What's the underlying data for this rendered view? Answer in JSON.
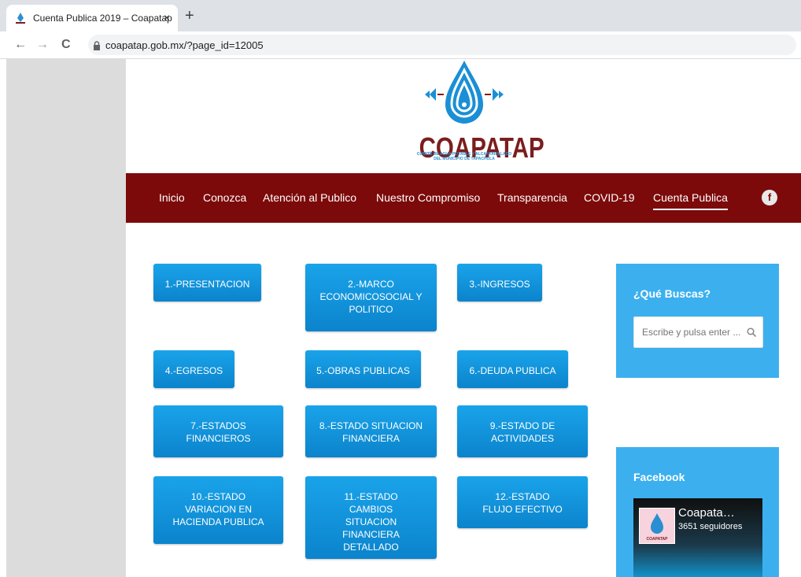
{
  "browser": {
    "tab_title": "Cuenta Publica 2019 – Coapatap",
    "tab_close": "×",
    "new_tab": "+",
    "url": "coapatap.gob.mx/?page_id=12005",
    "back": "←",
    "forward": "→",
    "reload": "C"
  },
  "header": {
    "logo_text": "COAPATAP",
    "logo_subtitle_1": "COMITÉ DE AGUA POTABLE Y ALCANTARILLADO",
    "logo_subtitle_2": "DEL MUNICIPIO DE TAPACHULA"
  },
  "nav": {
    "items": [
      {
        "label": "Inicio"
      },
      {
        "label": "Conozca"
      },
      {
        "label": "Atención al Publico"
      },
      {
        "label": "Nuestro Compromiso"
      },
      {
        "label": "Transparencia"
      },
      {
        "label": "COVID-19"
      },
      {
        "label": "Cuenta Publica",
        "active": true
      }
    ],
    "facebook_icon_glyph": "f"
  },
  "buttons": [
    {
      "label": "1.-PRESENTACION"
    },
    {
      "label": "2.-MARCO ECONOMICOSOCIAL Y POLITICO"
    },
    {
      "label": "3.-INGRESOS"
    },
    {
      "label": "4.-EGRESOS"
    },
    {
      "label": "5.-OBRAS PUBLICAS"
    },
    {
      "label": "6.-DEUDA PUBLICA"
    },
    {
      "label": "7.-ESTADOS FINANCIEROS"
    },
    {
      "label": "8.-ESTADO SITUACION FINANCIERA"
    },
    {
      "label": "9.-ESTADO DE ACTIVIDADES"
    },
    {
      "label": "10.-ESTADO VARIACION EN HACIENDA PUBLICA"
    },
    {
      "label": "11.-ESTADO CAMBIOS SITUACION FINANCIERA DETALLADO"
    },
    {
      "label": "12.-ESTADO FLUJO EFECTIVO"
    }
  ],
  "sidebar": {
    "search_title": "¿Qué Buscas?",
    "search_placeholder": "Escribe y pulsa enter ...",
    "facebook_title": "Facebook",
    "fb_page_name": "Coapata…",
    "fb_followers": "3651 seguidores",
    "fb_thumb_text": "COAPATAP"
  },
  "colors": {
    "nav_bg": "#7c0a0a",
    "button_blue": "#1296dc",
    "widget_blue": "#3cb0ef",
    "logo_maroon": "#7c1d1d"
  }
}
